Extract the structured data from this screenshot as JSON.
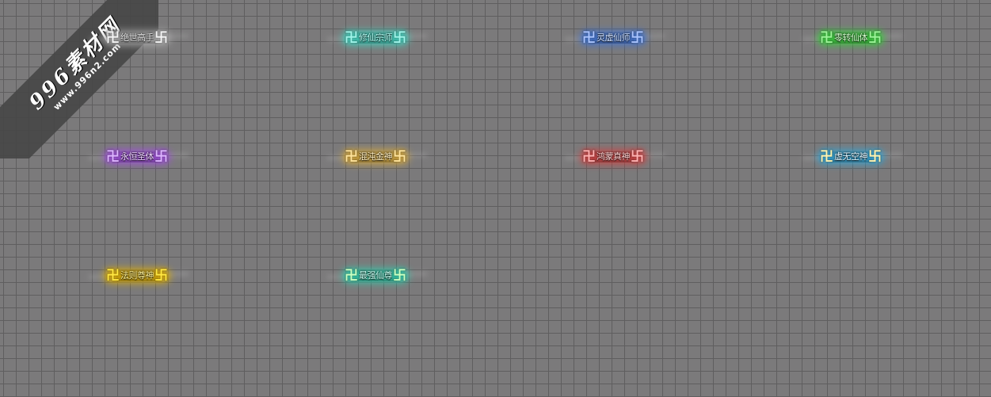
{
  "watermark": {
    "main": "996素材网",
    "sub": "www.996n2.com"
  },
  "titles": [
    {
      "symbol": "卍",
      "label": "绝世高手",
      "color": "#e8e8e8",
      "glow": "#b0b0b0",
      "symbol_color": "#f4f4f4"
    },
    {
      "symbol": "卍",
      "label": "修仙宗师",
      "color": "#b9fff6",
      "glow": "#3fd6c2",
      "symbol_color": "#9ff5ea"
    },
    {
      "symbol": "卍",
      "label": "灵虚仙师",
      "color": "#cfe0ff",
      "glow": "#3f74d6",
      "symbol_color": "#a9c4ff"
    },
    {
      "symbol": "卍",
      "label": "零转仙体",
      "color": "#d6ffcf",
      "glow": "#37d23a",
      "symbol_color": "#9cf598"
    },
    {
      "symbol": "卍",
      "label": "永恒圣体",
      "color": "#efd6ff",
      "glow": "#a14de0",
      "symbol_color": "#dcb3ff"
    },
    {
      "symbol": "卍",
      "label": "混沌金神",
      "color": "#fff0c4",
      "glow": "#d8a93a",
      "symbol_color": "#ffe39a"
    },
    {
      "symbol": "卍",
      "label": "鸿蒙真神",
      "color": "#ffd2d2",
      "glow": "#d24040",
      "symbol_color": "#ffb1b1"
    },
    {
      "symbol": "卍",
      "label": "虚无空神",
      "color": "#e2f6ff",
      "glow": "#2fa6d8",
      "symbol_color": "#fff3b0"
    },
    {
      "symbol": "卍",
      "label": "法则尊神",
      "color": "#fff39a",
      "glow": "#e0b000",
      "symbol_color": "#ffe640"
    },
    {
      "symbol": "卍",
      "label": "最强仙尊",
      "color": "#c9fff2",
      "glow": "#2fcfae",
      "symbol_color": "#c8ffc0"
    }
  ]
}
